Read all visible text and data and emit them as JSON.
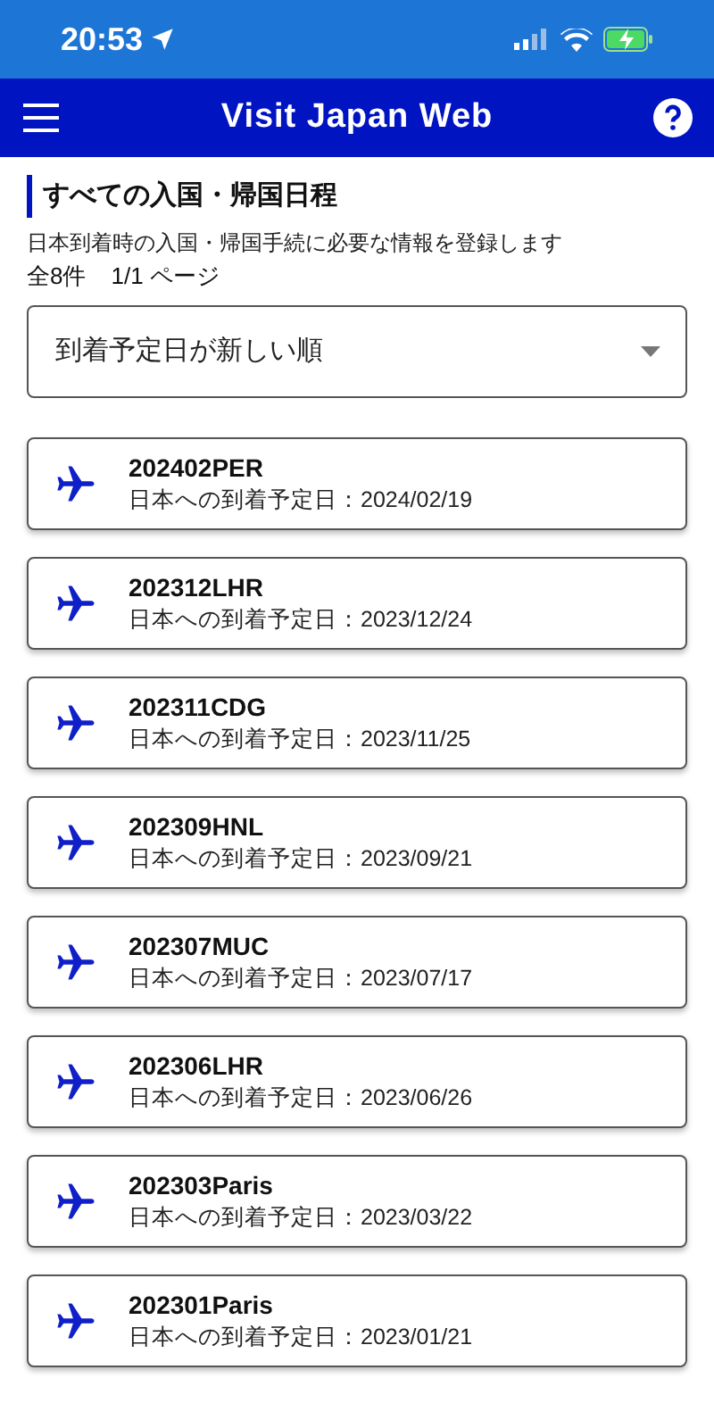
{
  "status_bar": {
    "time": "20:53"
  },
  "header": {
    "title": "Visit Japan Web"
  },
  "section": {
    "title": "すべての入国・帰国日程",
    "description": "日本到着時の入国・帰国手続に必要な情報を登録します",
    "total": "全8件",
    "page": "1/1 ページ"
  },
  "sort_select": {
    "value": "到着予定日が新しい順"
  },
  "trips": [
    {
      "name": "202402PER",
      "arrival": "日本への到着予定日：2024/02/19"
    },
    {
      "name": "202312LHR",
      "arrival": "日本への到着予定日：2023/12/24"
    },
    {
      "name": "202311CDG",
      "arrival": "日本への到着予定日：2023/11/25"
    },
    {
      "name": "202309HNL",
      "arrival": "日本への到着予定日：2023/09/21"
    },
    {
      "name": "202307MUC",
      "arrival": "日本への到着予定日：2023/07/17"
    },
    {
      "name": "202306LHR",
      "arrival": "日本への到着予定日：2023/06/26"
    },
    {
      "name": "202303Paris",
      "arrival": "日本への到着予定日：2023/03/22"
    },
    {
      "name": "202301Paris",
      "arrival": "日本への到着予定日：2023/01/21"
    }
  ]
}
